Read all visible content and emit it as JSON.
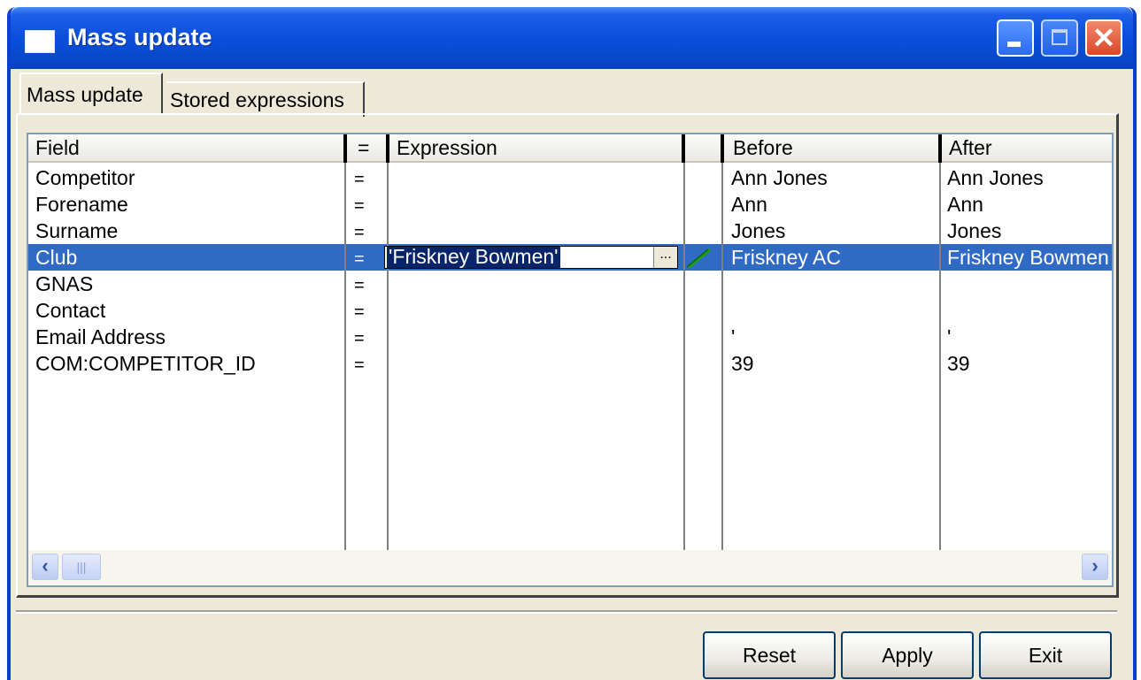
{
  "window": {
    "title": "Mass update"
  },
  "tabs": [
    {
      "label": "Mass update",
      "active": true
    },
    {
      "label": "Stored expressions",
      "active": false
    }
  ],
  "grid": {
    "columns": [
      "Field",
      "=",
      "Expression",
      "",
      "Before",
      "After"
    ],
    "rows": [
      {
        "field": "Competitor",
        "op": "=",
        "expression": "",
        "before": "Ann Jones",
        "after": "Ann Jones"
      },
      {
        "field": "Forename",
        "op": "=",
        "expression": "",
        "before": "Ann",
        "after": "Ann"
      },
      {
        "field": "Surname",
        "op": "=",
        "expression": "",
        "before": "Jones",
        "after": "Jones"
      },
      {
        "field": "Club",
        "op": "=",
        "expression": "'Friskney Bowmen'",
        "before": "Friskney AC",
        "after": "Friskney Bowmen",
        "selected": true
      },
      {
        "field": "GNAS",
        "op": "=",
        "expression": "",
        "before": "",
        "after": ""
      },
      {
        "field": "Contact",
        "op": "=",
        "expression": "",
        "before": "",
        "after": ""
      },
      {
        "field": "Email Address",
        "op": "=",
        "expression": "",
        "before": "'",
        "after": "'"
      },
      {
        "field": "COM:COMPETITOR_ID",
        "op": "=",
        "expression": "",
        "before": "39",
        "after": "39"
      }
    ],
    "lookup_button_label": "...",
    "colors": {
      "selection": "#316ac5",
      "edit_selection": "#0a246a"
    }
  },
  "buttons": {
    "reset": "Reset",
    "apply": "Apply",
    "exit": "Exit"
  },
  "icons": {
    "window": "window-icon",
    "minimize": "minimize-icon",
    "maximize": "maximize-icon",
    "close": "close-icon",
    "changed": "pencil-icon",
    "scroll_left": "chevron-left-icon",
    "scroll_right": "chevron-right-icon"
  }
}
